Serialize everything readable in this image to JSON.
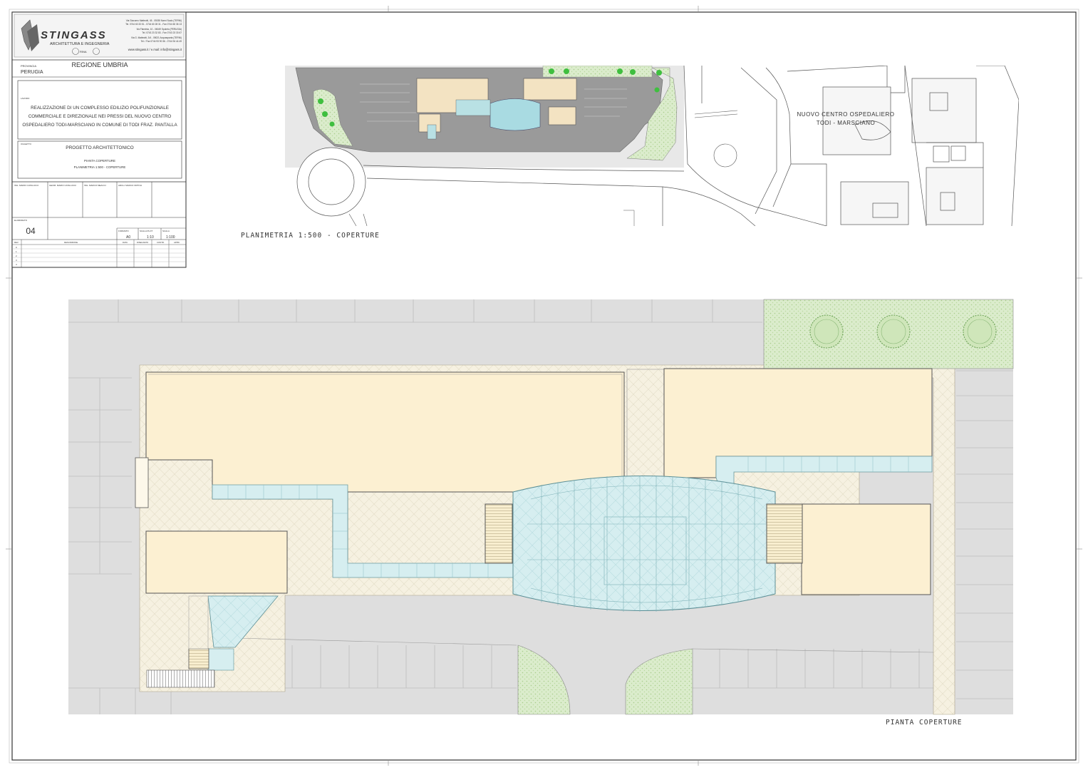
{
  "firm": {
    "name": "STINGASS",
    "tagline": "ARCHITETTURA E INGEGNERIA",
    "address_1": "Via Giacomo Matteotti, 45 - 05035 Narni Scalo (TERNI)",
    "contact_1": "Tel. 0744 60 33 51 - 0744 60 28 31 - Fax 0744 60 36 13",
    "address_2": "Via Flaminia, 10 - 06049 Spoleto (PERUGIA)",
    "contact_2": "Tel. 0743 23 32 83 - Fax 0743 23 33 67",
    "address_3": "Via G. Matteotti, 3/4 - 05021 Acquasparta (TERNI)",
    "contact_3": "Tel. / Fax 0744 93 90 36 - 0744 94 44 49",
    "web": "www.stingass.it / e.mail: info@stingass.it",
    "cert": "RINA"
  },
  "title_block": {
    "province_label": "PROVINCIA",
    "province": "PERUGIA",
    "region": "REGIONE UMBRIA",
    "lavoro_label": "LAVORO",
    "project_line_1": "REALIZZAZIONE DI UN COMPLESSO EDILIZIO POLIFUNZIONALE",
    "project_line_2": "COMMERCIALE E DIREZIONALE NEI PRESSI DEL NUOVO CENTRO",
    "project_line_3": "OSPEDALIERO TODI-MARSCIANO IN COMUNE DI TODI FRAZ. PANTALLA",
    "oggetto_label": "OGGETTO",
    "subject": "PROGETTO ARCHITETTONICO",
    "subject_line_2": "PIANTA COPERTURE",
    "subject_line_3": "PLANIMETRIA 1:500 - COPERTURE",
    "sig_1": "ING. MARIO CATALUCCI",
    "sig_2": "GEOM. MARIO CATALUCCI",
    "sig_3": "ING. MARCO MEACCI",
    "sig_4": "ARCH. MARCO ORTOLI",
    "sheet_label": "ELABORATO",
    "sheet_number": "04",
    "format_label": "FORMATO",
    "format": "A0",
    "file_scale_label": "SCALA PLOT",
    "file_scale": "1:10",
    "scale_label": "SCALA",
    "scale": "1:100",
    "rev_header": [
      "REV.",
      "DESCRIZIONE",
      "DATA",
      "DISEGNATO",
      "CONTR.",
      "APPR."
    ],
    "rev_rows": [
      "0",
      "1",
      "2",
      "3",
      "4"
    ]
  },
  "site_plan": {
    "caption": "PLANIMETRIA 1:500 - COPERTURE",
    "hospital_line_1": "NUOVO CENTRO OSPEDALIERO",
    "hospital_line_2": "TODI - MARSCIANO"
  },
  "roof_plan": {
    "caption": "PIANTA COPERTURE"
  },
  "colors": {
    "roof": "#fcf0d2",
    "glass": "#d6eef0",
    "lawn": "#dbeccc",
    "tree": "#3fbf3f",
    "asphalt": "#dedede",
    "road": "#9a9a9a",
    "pavement": "#f6f1e1"
  }
}
